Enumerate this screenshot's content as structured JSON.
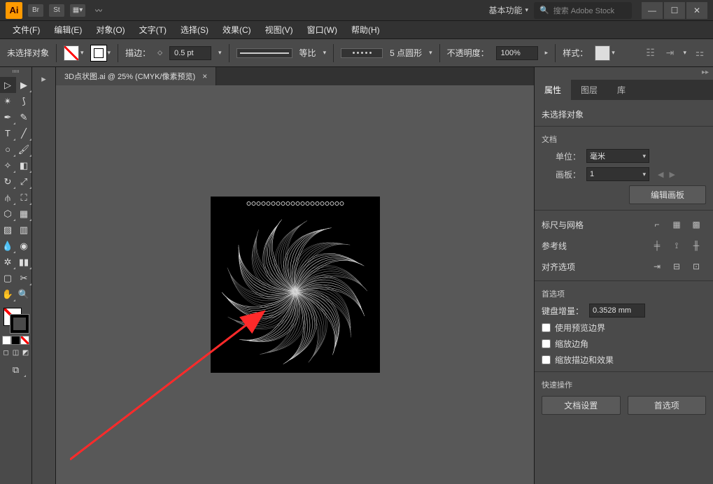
{
  "titlebar": {
    "br_label": "Br",
    "st_label": "St"
  },
  "workspace": {
    "label": "基本功能"
  },
  "search": {
    "placeholder": "搜索 Adobe Stock"
  },
  "menu": {
    "file": "文件(F)",
    "edit": "编辑(E)",
    "object": "对象(O)",
    "type": "文字(T)",
    "select": "选择(S)",
    "effect": "效果(C)",
    "view": "视图(V)",
    "window": "窗口(W)",
    "help": "帮助(H)"
  },
  "controlbar": {
    "no_selection": "未选择对象",
    "stroke_label": "描边：",
    "stroke_weight": "0.5 pt",
    "stroke_profile": "等比",
    "brush_label": "5 点圆形",
    "opacity_label": "不透明度：",
    "opacity_value": "100%",
    "style_label": "样式："
  },
  "document": {
    "tab_title": "3D点状图.ai @ 25% (CMYK/像素预览)"
  },
  "properties": {
    "tabs": {
      "properties": "属性",
      "layers": "图层",
      "libraries": "库"
    },
    "no_selection": "未选择对象",
    "doc_section": "文档",
    "units_label": "单位：",
    "units_value": "毫米",
    "artboard_label": "画板：",
    "artboard_value": "1",
    "edit_artboards": "编辑画板",
    "rulers_grid": "标尺与网格",
    "guides": "参考线",
    "align_options": "对齐选项",
    "preferences": "首选项",
    "nudge_label": "键盘增量：",
    "nudge_value": "0.3528 mm",
    "use_preview_bounds": "使用预览边界",
    "scale_corners": "缩放边角",
    "scale_stroke_effects": "缩放描边和效果",
    "quick_actions": "快速操作",
    "doc_setup": "文档设置",
    "prefs_btn": "首选项"
  }
}
